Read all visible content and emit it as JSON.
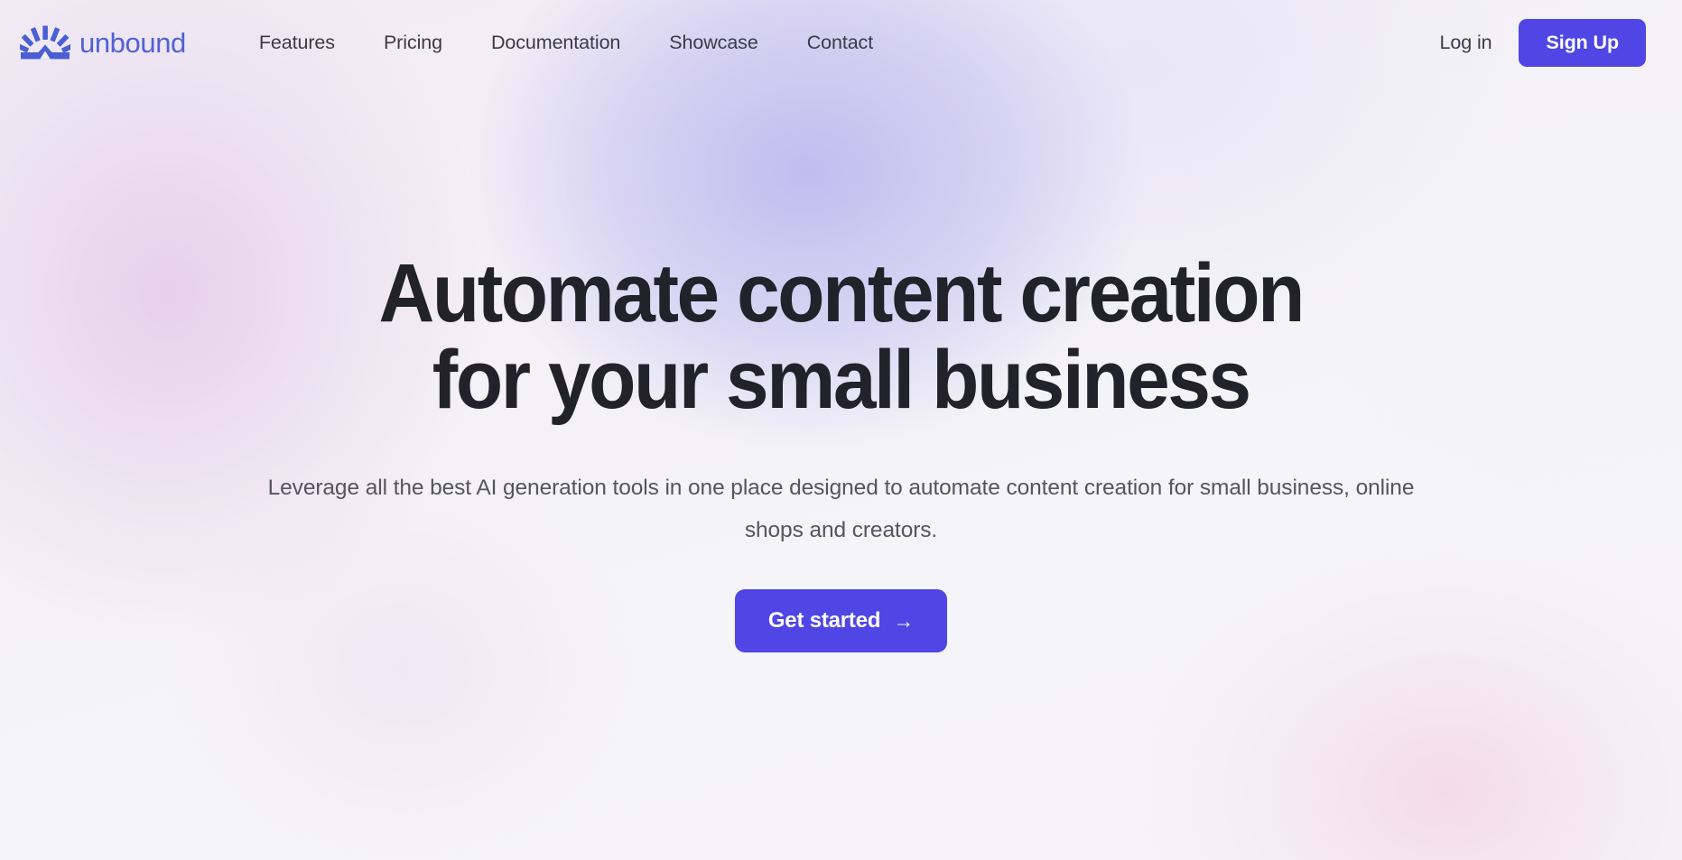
{
  "brand": {
    "name": "unbound",
    "logo_icon": "sunburst-icon",
    "color": "#5161d6"
  },
  "nav": {
    "items": [
      {
        "label": "Features"
      },
      {
        "label": "Pricing"
      },
      {
        "label": "Documentation"
      },
      {
        "label": "Showcase"
      },
      {
        "label": "Contact"
      }
    ],
    "login_label": "Log in",
    "signup_label": "Sign Up"
  },
  "hero": {
    "headline_line1": "Automate content creation",
    "headline_line2": "for your small business",
    "subhead": "Leverage all the best AI generation tools in one place designed to automate content creation for small business, online shops and creators.",
    "cta_label": "Get started",
    "cta_arrow": "→"
  },
  "theme": {
    "accent": "#4f46e5",
    "headline_color": "#22222b",
    "body_text_color": "#555561",
    "nav_text_color": "#3b3b47",
    "background_base": "#f4f4f7",
    "background_lavender": "#bcb8ee",
    "background_pink": "#f3d6ea"
  }
}
